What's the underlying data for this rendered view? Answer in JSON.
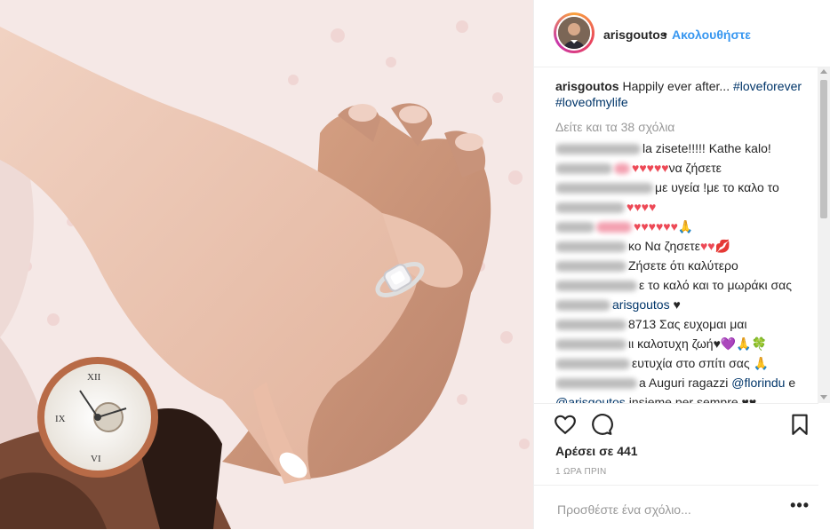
{
  "post": {
    "username": "arisgoutos",
    "separator": "•",
    "follow_label": "Ακολουθήστε",
    "caption_user": "arisgoutos",
    "caption_text": "Happily ever after...",
    "caption_tag1": "#loveforever",
    "caption_tag2": "#loveofmylife",
    "view_all": "Δείτε και τα 38 σχόλια",
    "likes": "Αρέσει σε 441",
    "time": "1 ΩΡΑ ΠΡΙΝ",
    "add_comment_placeholder": "Προσθέστε ένα σχόλιο...",
    "more_label": "•••"
  },
  "comments": [
    {
      "text": "la zisete!!!!! Kathe kalo!"
    },
    {
      "text": "να ζήσετε",
      "hearts": "♥♥♥♥♥"
    },
    {
      "text": "με υγεία !με το καλο το"
    },
    {
      "hearts": "♥♥♥♥"
    },
    {
      "hearts": "♥♥♥♥♥♥",
      "emoji": "🙏"
    },
    {
      "text": "κο Να ζησετε",
      "hearts": "♥♥",
      "emoji": "💋"
    },
    {
      "text": "Ζήσετε ότι καλύτερο"
    },
    {
      "text": "ε το καλό και το μωράκι σας"
    },
    {
      "mention": "arisgoutos",
      "hearts": "♥"
    },
    {
      "text": "8713 Σας ευχομαι μαι"
    },
    {
      "text": "ιι καλοτυχη ζωή",
      "hearts": "♥💜",
      "emoji": "🙏🍀"
    },
    {
      "text": "ευτυχία στο σπίτι σας",
      "emoji": "🙏"
    },
    {
      "text": "a Auguri ragazzi",
      "mention": "florindu",
      "tail": "e"
    },
    {
      "mention": "arisgoutos",
      "text": "insieme per sempre",
      "hearts": "♥♥"
    }
  ],
  "colors": {
    "link": "#003569",
    "follow": "#3897f0",
    "heart": "#ed4956",
    "muted": "#999999"
  },
  "icons": [
    "heart-icon",
    "comment-icon",
    "bookmark-icon",
    "more-options-icon"
  ]
}
